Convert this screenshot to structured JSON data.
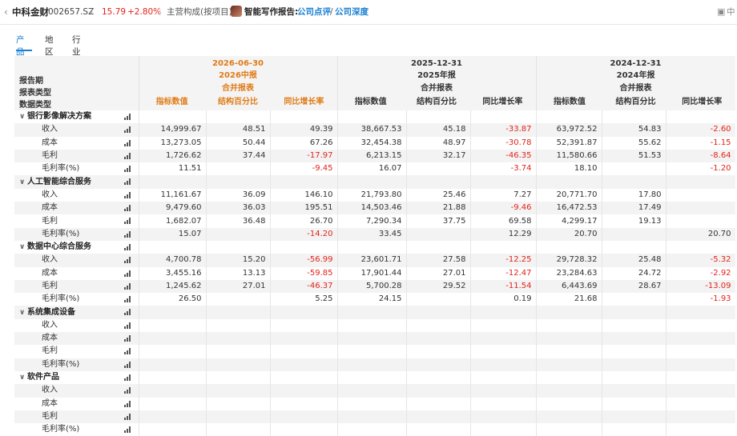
{
  "header": {
    "back_icon": "chevron-left-icon",
    "stock_name": "中科金财",
    "stock_code": "002657.SZ",
    "chevron": "›",
    "price": "15.79",
    "change": "+2.80%",
    "breadcrumb": "主营构成(按项目)",
    "report_label": "智能写作报告:",
    "link1": "公司点评",
    "slash": "/",
    "link2": "公司深度",
    "panel_label": "中"
  },
  "tabs": [
    {
      "label": "产品",
      "active": true
    },
    {
      "label": "地区",
      "active": false
    },
    {
      "label": "行业",
      "active": false
    }
  ],
  "table": {
    "meta_labels": [
      "报告期",
      "报表类型",
      "数据类型"
    ],
    "periods": [
      {
        "date": "2026-06-30",
        "name": "2026中报",
        "type": "合并报表",
        "current": true
      },
      {
        "date": "2025-12-31",
        "name": "2025年报",
        "type": "合并报表",
        "current": false
      },
      {
        "date": "2024-12-31",
        "name": "2024年报",
        "type": "合并报表",
        "current": false
      }
    ],
    "subheaders": [
      "指标数值",
      "结构百分比",
      "同比增长率"
    ],
    "rows": [
      {
        "group": true,
        "label": "银行影像解决方案",
        "vals": [
          "",
          "",
          "",
          "",
          "",
          "",
          "",
          "",
          ""
        ]
      },
      {
        "label": "收入",
        "vals": [
          "14,999.67",
          "48.51",
          "49.39",
          "38,667.53",
          "45.18",
          "-33.87",
          "63,972.52",
          "54.83",
          "-2.60"
        ]
      },
      {
        "label": "成本",
        "vals": [
          "13,273.05",
          "50.44",
          "67.26",
          "32,454.38",
          "48.97",
          "-30.78",
          "52,391.87",
          "55.62",
          "-1.15"
        ]
      },
      {
        "label": "毛利",
        "vals": [
          "1,726.62",
          "37.44",
          "-17.97",
          "6,213.15",
          "32.17",
          "-46.35",
          "11,580.66",
          "51.53",
          "-8.64"
        ]
      },
      {
        "label": "毛利率(%)",
        "vals": [
          "11.51",
          "",
          "-9.45",
          "16.07",
          "",
          "-3.74",
          "18.10",
          "",
          "-1.20"
        ]
      },
      {
        "group": true,
        "label": "人工智能综合服务",
        "vals": [
          "",
          "",
          "",
          "",
          "",
          "",
          "",
          "",
          ""
        ]
      },
      {
        "label": "收入",
        "vals": [
          "11,161.67",
          "36.09",
          "146.10",
          "21,793.80",
          "25.46",
          "7.27",
          "20,771.70",
          "17.80",
          ""
        ]
      },
      {
        "label": "成本",
        "vals": [
          "9,479.60",
          "36.03",
          "195.51",
          "14,503.46",
          "21.88",
          "-9.46",
          "16,472.53",
          "17.49",
          ""
        ]
      },
      {
        "label": "毛利",
        "vals": [
          "1,682.07",
          "36.48",
          "26.70",
          "7,290.34",
          "37.75",
          "69.58",
          "4,299.17",
          "19.13",
          ""
        ]
      },
      {
        "label": "毛利率(%)",
        "vals": [
          "15.07",
          "",
          "-14.20",
          "33.45",
          "",
          "12.29",
          "20.70",
          "",
          "20.70"
        ]
      },
      {
        "group": true,
        "label": "数据中心综合服务",
        "vals": [
          "",
          "",
          "",
          "",
          "",
          "",
          "",
          "",
          ""
        ]
      },
      {
        "label": "收入",
        "vals": [
          "4,700.78",
          "15.20",
          "-56.99",
          "23,601.71",
          "27.58",
          "-12.25",
          "29,728.32",
          "25.48",
          "-5.32"
        ]
      },
      {
        "label": "成本",
        "vals": [
          "3,455.16",
          "13.13",
          "-59.85",
          "17,901.44",
          "27.01",
          "-12.47",
          "23,284.63",
          "24.72",
          "-2.92"
        ]
      },
      {
        "label": "毛利",
        "vals": [
          "1,245.62",
          "27.01",
          "-46.37",
          "5,700.28",
          "29.52",
          "-11.54",
          "6,443.69",
          "28.67",
          "-13.09"
        ]
      },
      {
        "label": "毛利率(%)",
        "vals": [
          "26.50",
          "",
          "5.25",
          "24.15",
          "",
          "0.19",
          "21.68",
          "",
          "-1.93"
        ]
      },
      {
        "group": true,
        "label": "系统集成设备",
        "vals": [
          "",
          "",
          "",
          "",
          "",
          "",
          "",
          "",
          ""
        ]
      },
      {
        "label": "收入",
        "vals": [
          "",
          "",
          "",
          "",
          "",
          "",
          "",
          "",
          ""
        ]
      },
      {
        "label": "成本",
        "vals": [
          "",
          "",
          "",
          "",
          "",
          "",
          "",
          "",
          ""
        ]
      },
      {
        "label": "毛利",
        "vals": [
          "",
          "",
          "",
          "",
          "",
          "",
          "",
          "",
          ""
        ]
      },
      {
        "label": "毛利率(%)",
        "vals": [
          "",
          "",
          "",
          "",
          "",
          "",
          "",
          "",
          ""
        ]
      },
      {
        "group": true,
        "label": "软件产品",
        "vals": [
          "",
          "",
          "",
          "",
          "",
          "",
          "",
          "",
          ""
        ]
      },
      {
        "label": "收入",
        "vals": [
          "",
          "",
          "",
          "",
          "",
          "",
          "",
          "",
          ""
        ]
      },
      {
        "label": "成本",
        "vals": [
          "",
          "",
          "",
          "",
          "",
          "",
          "",
          "",
          ""
        ]
      },
      {
        "label": "毛利",
        "vals": [
          "",
          "",
          "",
          "",
          "",
          "",
          "",
          "",
          ""
        ]
      },
      {
        "label": "毛利率(%)",
        "vals": [
          "",
          "",
          "",
          "",
          "",
          "",
          "",
          "",
          ""
        ]
      }
    ]
  },
  "colors": {
    "accent": "#1a7fd1",
    "negative": "#e2231a",
    "current_period": "#e07b16"
  }
}
